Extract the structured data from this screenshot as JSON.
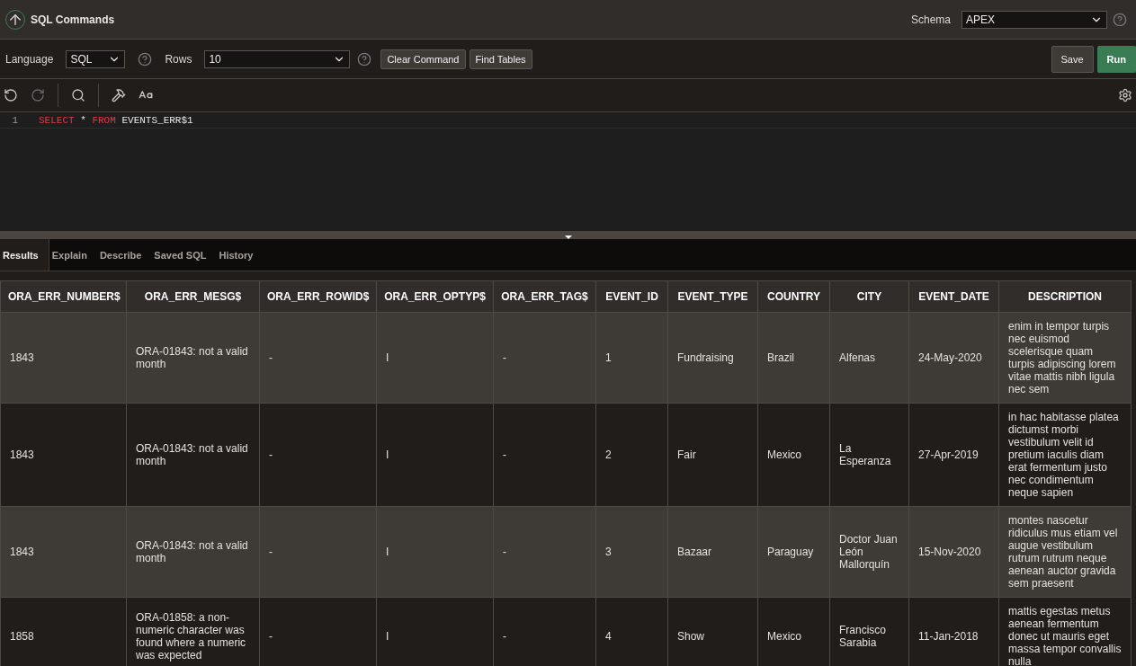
{
  "header": {
    "title": "SQL Commands",
    "schema_label": "Schema",
    "schema_value": "APEX"
  },
  "toolbar": {
    "language_label": "Language",
    "language_value": "SQL",
    "rows_label": "Rows",
    "rows_value": "10",
    "buttons": [
      {
        "label": "Clear Command"
      },
      {
        "label": "Find Tables"
      }
    ],
    "save": "Save",
    "run": "Run"
  },
  "editor": {
    "lines": [
      {
        "number": "1",
        "tokens": [
          {
            "text": "SELECT",
            "kind": "keyword"
          },
          {
            "text": " * ",
            "kind": "plain"
          },
          {
            "text": "FROM",
            "kind": "keyword"
          },
          {
            "text": " EVENTS_ERR$1",
            "kind": "plain"
          }
        ]
      }
    ]
  },
  "tabs": [
    {
      "label": "Results",
      "selected": true
    },
    {
      "label": "Explain",
      "selected": false
    },
    {
      "label": "Describe",
      "selected": false
    },
    {
      "label": "Saved SQL",
      "selected": false
    },
    {
      "label": "History",
      "selected": false
    }
  ],
  "table": {
    "columns": [
      "ORA_ERR_NUMBER$",
      "ORA_ERR_MESG$",
      "ORA_ERR_ROWID$",
      "ORA_ERR_OPTYP$",
      "ORA_ERR_TAG$",
      "EVENT_ID",
      "EVENT_TYPE",
      "COUNTRY",
      "CITY",
      "EVENT_DATE",
      "DESCRIPTION"
    ],
    "rows": [
      [
        "1843",
        "ORA-01843: not a valid month",
        "-",
        "I",
        "-",
        "1",
        "Fundraising",
        "Brazil",
        "Alfenas",
        "24-May-2020",
        "enim in tempor turpis nec euismod scelerisque quam turpis adipiscing lorem vitae mattis nibh ligula nec sem"
      ],
      [
        "1843",
        "ORA-01843: not a valid month",
        "-",
        "I",
        "-",
        "2",
        "Fair",
        "Mexico",
        "La Esperanza",
        "27-Apr-2019",
        "in hac habitasse platea dictumst morbi vestibulum velit id pretium iaculis diam erat fermentum justo nec condimentum neque sapien"
      ],
      [
        "1843",
        "ORA-01843: not a valid month",
        "-",
        "I",
        "-",
        "3",
        "Bazaar",
        "Paraguay",
        "Doctor Juan León Mallorquín",
        "15-Nov-2020",
        "montes nascetur ridiculus mus etiam vel augue vestibulum rutrum rutrum neque aenean auctor gravida sem praesent"
      ],
      [
        "1858",
        "ORA-01858: a non-numeric character was found where a numeric was expected",
        "-",
        "I",
        "-",
        "4",
        "Show",
        "Mexico",
        "Francisco Sarabia",
        "11-Jan-2018",
        "mattis egestas metus aenean fermentum donec ut mauris eget massa tempor convallis nulla"
      ]
    ]
  }
}
